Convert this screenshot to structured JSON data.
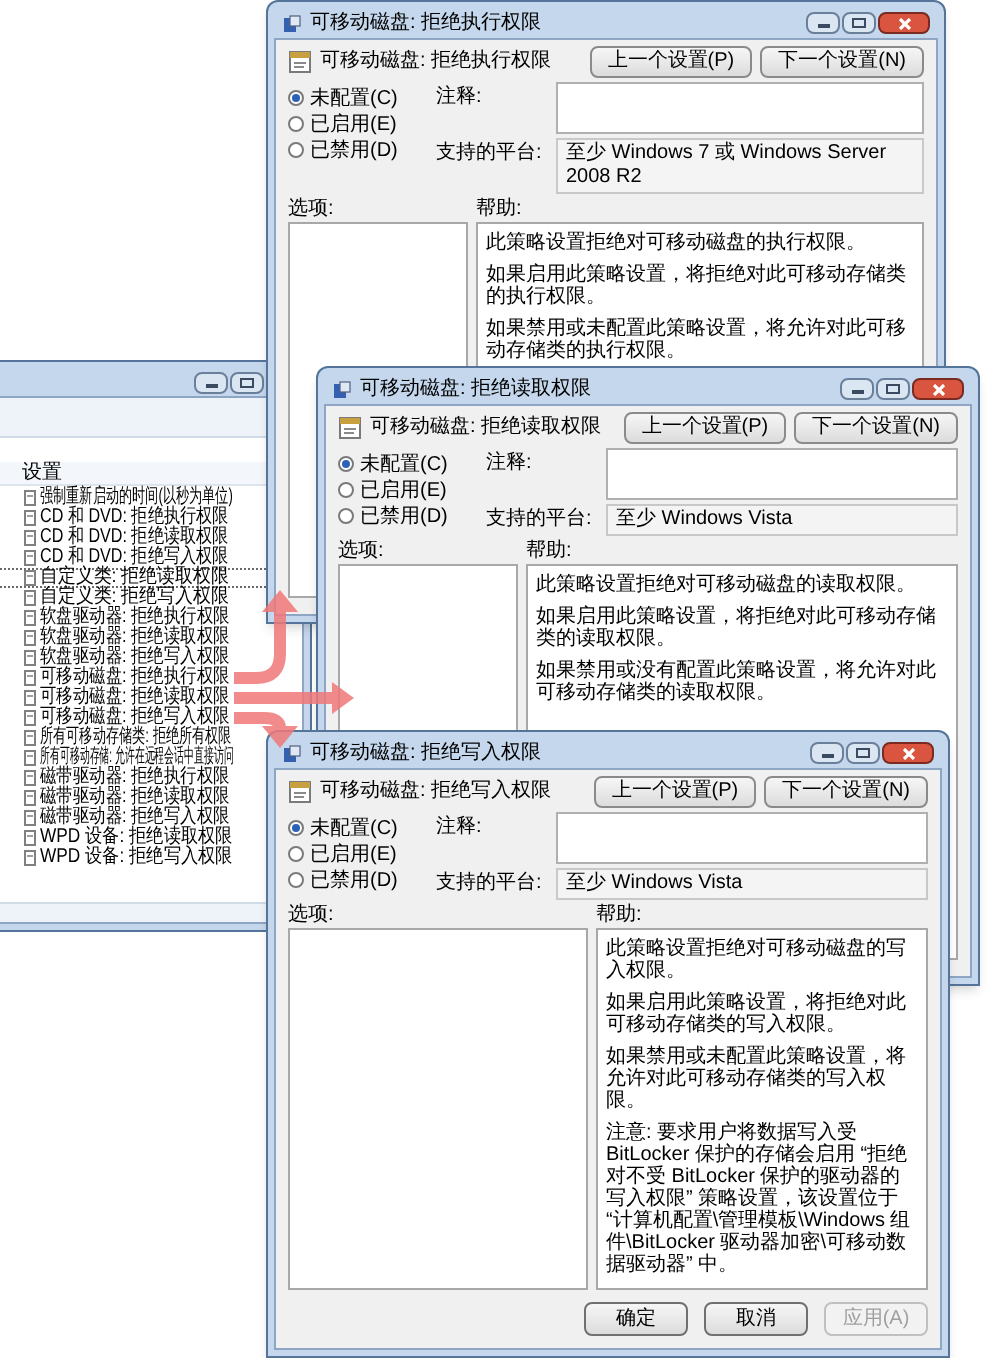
{
  "list_window": {
    "column_header": "设置",
    "items": [
      {
        "label": "强制重新启动的时间(以秒为单位)",
        "selected": false
      },
      {
        "label": "CD 和 DVD: 拒绝执行权限",
        "selected": false
      },
      {
        "label": "CD 和 DVD: 拒绝读取权限",
        "selected": false
      },
      {
        "label": "CD 和 DVD: 拒绝写入权限",
        "selected": false
      },
      {
        "label": "自定义类: 拒绝读取权限",
        "selected": true
      },
      {
        "label": "自定义类: 拒绝写入权限",
        "selected": false
      },
      {
        "label": "软盘驱动器: 拒绝执行权限",
        "selected": false
      },
      {
        "label": "软盘驱动器: 拒绝读取权限",
        "selected": false
      },
      {
        "label": "软盘驱动器: 拒绝写入权限",
        "selected": false
      },
      {
        "label": "可移动磁盘: 拒绝执行权限",
        "selected": false
      },
      {
        "label": "可移动磁盘: 拒绝读取权限",
        "selected": false
      },
      {
        "label": "可移动磁盘: 拒绝写入权限",
        "selected": false
      },
      {
        "label": "所有可移动存储类: 拒绝所有权限",
        "selected": false
      },
      {
        "label": "所有可移动存储: 允许在远程会话中直接访问",
        "selected": false
      },
      {
        "label": "磁带驱动器: 拒绝执行权限",
        "selected": false
      },
      {
        "label": "磁带驱动器: 拒绝读取权限",
        "selected": false
      },
      {
        "label": "磁带驱动器: 拒绝写入权限",
        "selected": false
      },
      {
        "label": "WPD 设备: 拒绝读取权限",
        "selected": false
      },
      {
        "label": "WPD 设备: 拒绝写入权限",
        "selected": false
      }
    ]
  },
  "dialogs": [
    {
      "title": "可移动磁盘: 拒绝执行权限",
      "heading": "可移动磁盘: 拒绝执行权限",
      "prev_button": "上一个设置(P)",
      "next_button": "下一个设置(N)",
      "radios": [
        {
          "label": "未配置(C)",
          "selected": true
        },
        {
          "label": "已启用(E)",
          "selected": false
        },
        {
          "label": "已禁用(D)",
          "selected": false
        }
      ],
      "comment_label": "注释:",
      "platform_label": "支持的平台:",
      "platform": "至少 Windows 7 或 Windows Server 2008 R2",
      "options_label": "选项:",
      "help_label": "帮助:",
      "help": [
        "此策略设置拒绝对可移动磁盘的执行权限。",
        "如果启用此策略设置，将拒绝对此可移动存储类的执行权限。",
        "如果禁用或未配置此策略设置，将允许对此可移动存储类的执行权限。"
      ]
    },
    {
      "title": "可移动磁盘: 拒绝读取权限",
      "heading": "可移动磁盘: 拒绝读取权限",
      "prev_button": "上一个设置(P)",
      "next_button": "下一个设置(N)",
      "radios": [
        {
          "label": "未配置(C)",
          "selected": true
        },
        {
          "label": "已启用(E)",
          "selected": false
        },
        {
          "label": "已禁用(D)",
          "selected": false
        }
      ],
      "comment_label": "注释:",
      "platform_label": "支持的平台:",
      "platform": "至少 Windows Vista",
      "options_label": "选项:",
      "help_label": "帮助:",
      "help": [
        "此策略设置拒绝对可移动磁盘的读取权限。",
        "如果启用此策略设置，将拒绝对此可移动存储类的读取权限。",
        "如果禁用或没有配置此策略设置，将允许对此可移动存储类的读取权限。"
      ]
    },
    {
      "title": "可移动磁盘: 拒绝写入权限",
      "heading": "可移动磁盘: 拒绝写入权限",
      "prev_button": "上一个设置(P)",
      "next_button": "下一个设置(N)",
      "radios": [
        {
          "label": "未配置(C)",
          "selected": true
        },
        {
          "label": "已启用(E)",
          "selected": false
        },
        {
          "label": "已禁用(D)",
          "selected": false
        }
      ],
      "comment_label": "注释:",
      "platform_label": "支持的平台:",
      "platform": "至少 Windows Vista",
      "options_label": "选项:",
      "help_label": "帮助:",
      "help": [
        "此策略设置拒绝对可移动磁盘的写入权限。",
        "如果启用此策略设置，将拒绝对此可移动存储类的写入权限。",
        "如果禁用或未配置此策略设置，将允许对此可移动存储类的写入权限。",
        "注意: 要求用户将数据写入受 BitLocker 保护的存储会启用 “拒绝对不受 BitLocker 保护的驱动器的写入权限” 策略设置，该设置位于 “计算机配置\\管理模板\\Windows 组件\\BitLocker 驱动器加密\\可移动数据驱动器” 中。"
      ],
      "buttons": [
        {
          "label": "确定",
          "disabled": false
        },
        {
          "label": "取消",
          "disabled": false
        },
        {
          "label": "应用(A)",
          "disabled": true
        }
      ]
    }
  ]
}
